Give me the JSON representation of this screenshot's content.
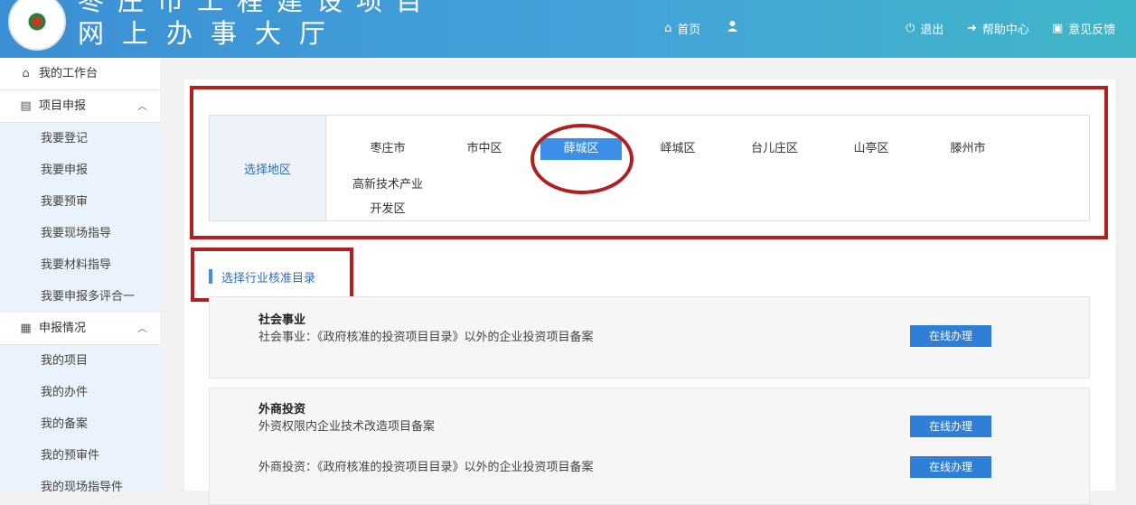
{
  "header": {
    "title_line1": "枣庄市工程建设项目",
    "title_line2": "网上办事大厅",
    "nav_home": "首页",
    "nav_logout": "退出",
    "nav_help": "帮助中心",
    "nav_feedback": "意见反馈"
  },
  "sidebar": {
    "workbench": "我的工作台",
    "group1": {
      "label": "项目申报",
      "items": [
        "我要登记",
        "我要申报",
        "我要预审",
        "我要现场指导",
        "我要材料指导",
        "我要申报多评合一"
      ]
    },
    "group2": {
      "label": "申报情况",
      "items": [
        "我的项目",
        "我的办件",
        "我的备案",
        "我的预审件",
        "我的现场指导件"
      ]
    }
  },
  "region": {
    "label": "选择地区",
    "options": [
      "枣庄市",
      "市中区",
      "薛城区",
      "峄城区",
      "台儿庄区",
      "山亭区",
      "滕州市",
      "高新技术产业开发区"
    ],
    "selected": "薛城区"
  },
  "catalog": {
    "title": "选择行业核准目录",
    "button_label": "在线办理",
    "sections": [
      {
        "title": "社会事业",
        "items": [
          "社会事业：《政府核准的投资项目目录》以外的企业投资项目备案"
        ]
      },
      {
        "title": "外商投资",
        "items": [
          "外资权限内企业技术改造项目备案",
          "外商投资：《政府核准的投资项目目录》以外的企业投资项目备案"
        ]
      }
    ]
  },
  "colors": {
    "accent": "#3d8ee8",
    "annotation_red": "#b21f1f",
    "sidebar_bg": "#eaf3fb"
  }
}
